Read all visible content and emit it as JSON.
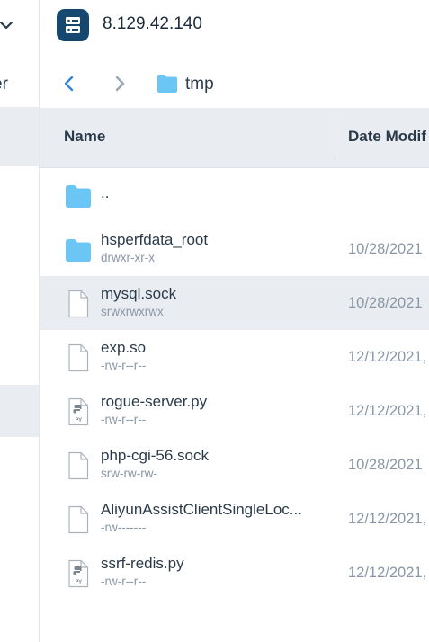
{
  "sidebar": {
    "partial_label": "er"
  },
  "header": {
    "host": "8.129.42.140"
  },
  "path": {
    "current": "tmp"
  },
  "columns": {
    "name": "Name",
    "date": "Date Modif"
  },
  "files": [
    {
      "name": "..",
      "perm": "",
      "date": "",
      "icon": "folder-icon"
    },
    {
      "name": "hsperfdata_root",
      "perm": "drwxr-xr-x",
      "date": "10/28/2021",
      "icon": "folder-icon"
    },
    {
      "name": "mysql.sock",
      "perm": "srwxrwxrwx",
      "date": "10/28/2021",
      "icon": "file-icon"
    },
    {
      "name": "exp.so",
      "perm": "-rw-r--r--",
      "date": "12/12/2021,",
      "icon": "file-icon"
    },
    {
      "name": "rogue-server.py",
      "perm": "-rw-r--r--",
      "date": "12/12/2021,",
      "icon": "python-file-icon"
    },
    {
      "name": "php-cgi-56.sock",
      "perm": "srw-rw-rw-",
      "date": "10/28/2021",
      "icon": "file-icon"
    },
    {
      "name": "AliyunAssistClientSingleLoc...",
      "perm": "-rw-------",
      "date": "12/12/2021,",
      "icon": "file-icon"
    },
    {
      "name": "ssrf-redis.py",
      "perm": "-rw-r--r--",
      "date": "12/12/2021,",
      "icon": "python-file-icon"
    }
  ],
  "colors": {
    "accent": "#2e86de",
    "folder": "#6cc6f5",
    "host_badge": "#16486f",
    "selected_row": "#e9edf1",
    "muted_text": "#8a97a6"
  }
}
